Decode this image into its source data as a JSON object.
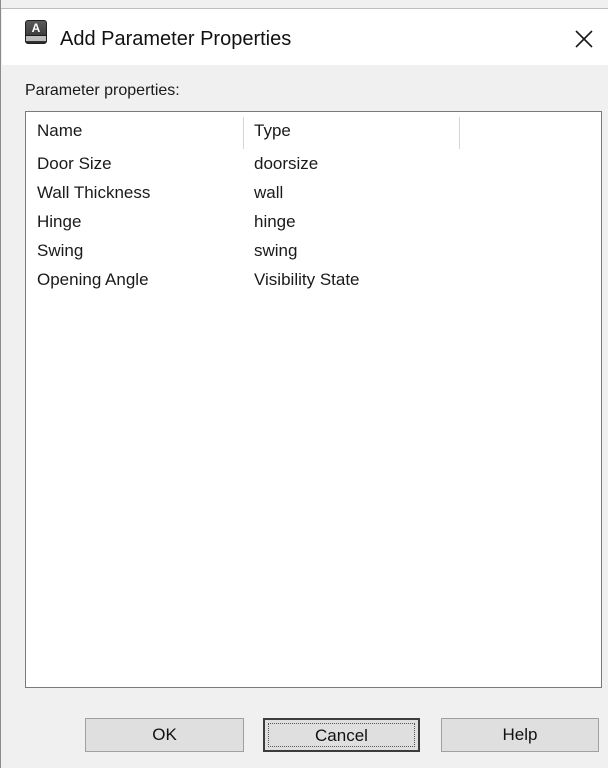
{
  "window": {
    "title": "Add Parameter Properties",
    "app_icon_letter": "A",
    "close_icon": "close-icon"
  },
  "properties": {
    "section_label": "Parameter properties:",
    "columns": {
      "name": "Name",
      "type": "Type"
    },
    "rows": [
      {
        "name": "Door Size",
        "type": "doorsize"
      },
      {
        "name": "Wall Thickness",
        "type": "wall"
      },
      {
        "name": "Hinge",
        "type": "hinge"
      },
      {
        "name": "Swing",
        "type": "swing"
      },
      {
        "name": "Opening Angle",
        "type": "Visibility State"
      }
    ]
  },
  "buttons": {
    "ok": "OK",
    "cancel": "Cancel",
    "help": "Help"
  }
}
